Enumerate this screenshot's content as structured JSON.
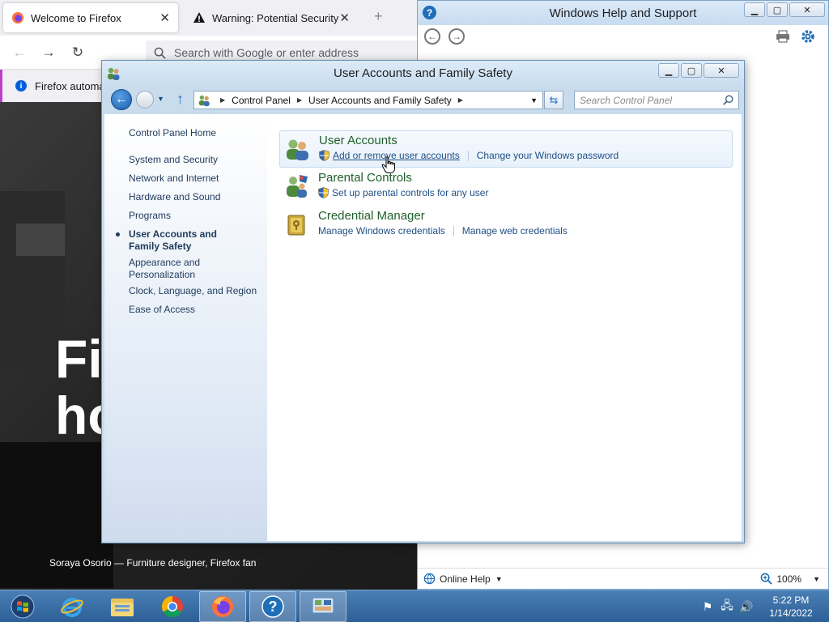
{
  "firefox": {
    "tabs": [
      {
        "label": "Welcome to Firefox",
        "active": true
      },
      {
        "label": "Warning: Potential Security Risk",
        "active": false
      }
    ],
    "url_placeholder": "Search with Google or enter address",
    "infobar_text": "Firefox automat",
    "hero_title": "Fir\nho",
    "hero_caption": "Soraya Osorio — Furniture designer, Firefox fan"
  },
  "help_window": {
    "title": "Windows Help and Support",
    "online_help": "Online Help",
    "zoom": "100%"
  },
  "control_panel": {
    "title": "User Accounts and Family Safety",
    "breadcrumb": [
      "Control Panel",
      "User Accounts and Family Safety"
    ],
    "search_placeholder": "Search Control Panel",
    "sidebar": {
      "home": "Control Panel Home",
      "items": [
        {
          "label": "System and Security",
          "current": false
        },
        {
          "label": "Network and Internet",
          "current": false
        },
        {
          "label": "Hardware and Sound",
          "current": false
        },
        {
          "label": "Programs",
          "current": false
        },
        {
          "label": "User Accounts and Family Safety",
          "current": true
        },
        {
          "label": "Appearance and Personalization",
          "current": false
        },
        {
          "label": "Clock, Language, and Region",
          "current": false
        },
        {
          "label": "Ease of Access",
          "current": false
        }
      ]
    },
    "categories": [
      {
        "title": "User Accounts",
        "links": [
          {
            "label": "Add or remove user accounts",
            "shield": true,
            "hover": true
          },
          {
            "label": "Change your Windows password",
            "shield": false
          }
        ]
      },
      {
        "title": "Parental Controls",
        "links": [
          {
            "label": "Set up parental controls for any user",
            "shield": true
          }
        ]
      },
      {
        "title": "Credential Manager",
        "links": [
          {
            "label": "Manage Windows credentials",
            "shield": false
          },
          {
            "label": "Manage web credentials",
            "shield": false
          }
        ]
      }
    ]
  },
  "taskbar": {
    "time": "5:22 PM",
    "date": "1/14/2022"
  },
  "colors": {
    "category_title": "#1e5f2a",
    "link": "#1e4f86",
    "taskbar": "#2c5f96"
  }
}
